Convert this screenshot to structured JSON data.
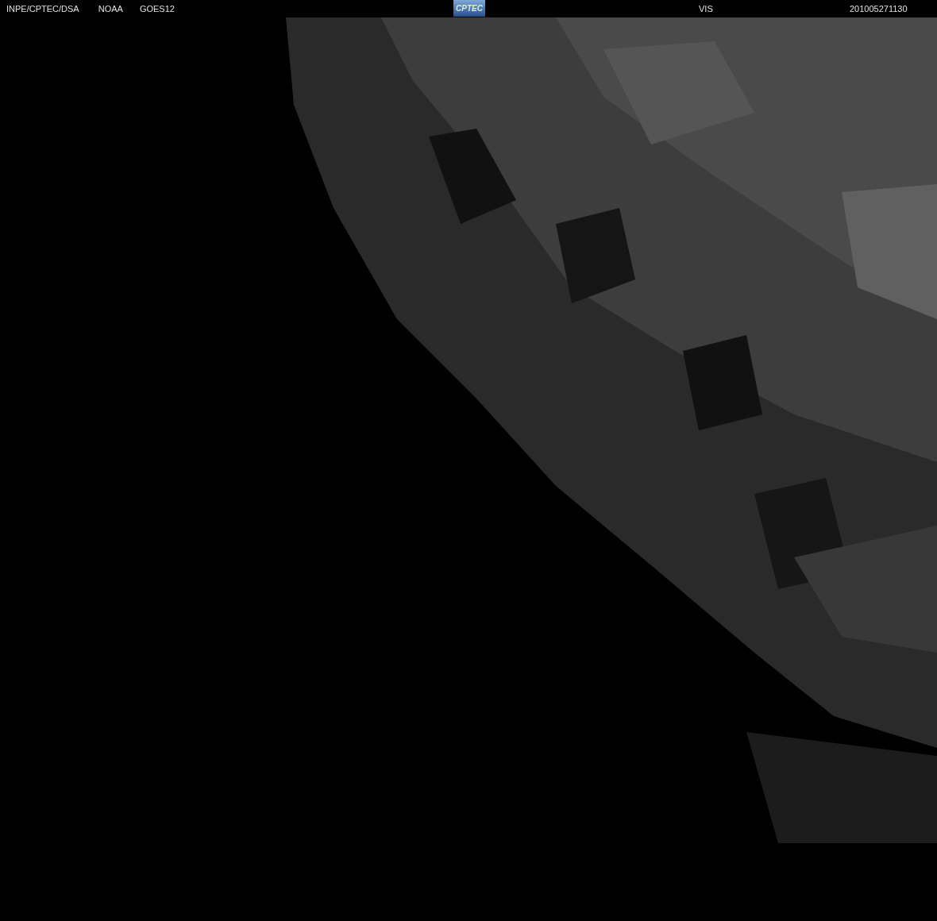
{
  "header": {
    "source": "INPE/CPTEC/DSA",
    "agency": "NOAA",
    "satellite": "GOES12",
    "logo": "CPTEC",
    "channel": "VIS",
    "timestamp": "201005271130"
  }
}
